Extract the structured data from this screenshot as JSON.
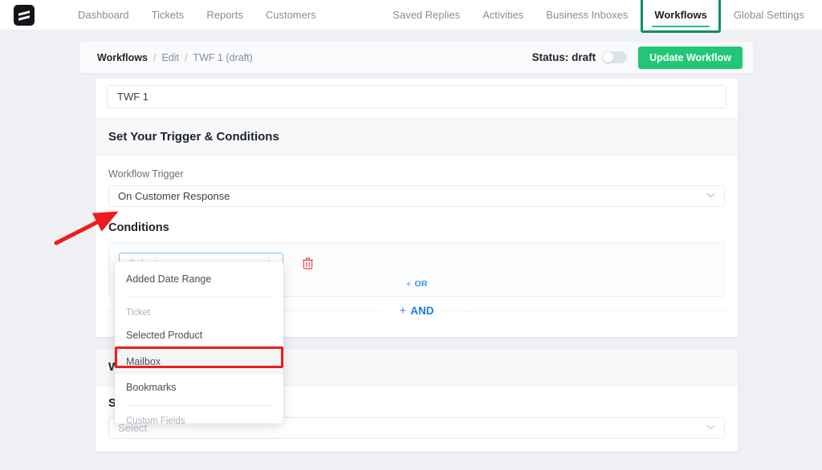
{
  "brand": {
    "logo_name": "app-logo",
    "accent_green": "#22c776",
    "highlight_green": "#0c9060",
    "annotation_red": "#ee1c1c",
    "link_blue": "#1681d8"
  },
  "topnav": {
    "left_items": [
      {
        "label": "Dashboard"
      },
      {
        "label": "Tickets"
      },
      {
        "label": "Reports"
      },
      {
        "label": "Customers"
      }
    ],
    "right_items": [
      {
        "label": "Saved Replies"
      },
      {
        "label": "Activities"
      },
      {
        "label": "Business Inboxes"
      }
    ],
    "active_item": {
      "label": "Workflows"
    },
    "trailing_item": {
      "label": "Global Settings"
    }
  },
  "breadcrumb": {
    "items": [
      {
        "label": "Workflows"
      },
      {
        "label": "Edit"
      },
      {
        "label": "TWF 1 (draft)"
      }
    ],
    "separator": "/"
  },
  "status": {
    "label": "Status: draft",
    "toggle_state": "off",
    "update_button": "Update Workflow"
  },
  "workflow": {
    "name_value": "TWF 1",
    "section_title": "Set Your Trigger & Conditions",
    "trigger_label": "Workflow Trigger",
    "trigger_value": "On Customer Response",
    "conditions_title": "Conditions",
    "condition_select_placeholder": "Select",
    "delete_icon": "trash-icon",
    "or_plus": "+",
    "or_label": "OR",
    "and_plus": "+",
    "and_label": "AND"
  },
  "dropdown": {
    "entries": [
      {
        "type": "item",
        "label": "Added Date Range",
        "hover": false
      },
      {
        "type": "separator"
      },
      {
        "type": "group",
        "label": "Ticket"
      },
      {
        "type": "item",
        "label": "Selected Product",
        "hover": false
      },
      {
        "type": "item",
        "label": "Mailbox",
        "hover": true
      },
      {
        "type": "item",
        "label": "Bookmarks",
        "hover": false
      },
      {
        "type": "separator"
      },
      {
        "type": "group",
        "label": "Custom Fields"
      }
    ]
  },
  "actions_card": {
    "section_title_partial": "W",
    "sub_label_partial": "S",
    "select_placeholder": "Select"
  },
  "annotations": {
    "arrow": {
      "name": "red-arrow-pointing-to-conditions"
    },
    "rect": {
      "name": "red-box-around-mailbox-option"
    }
  }
}
